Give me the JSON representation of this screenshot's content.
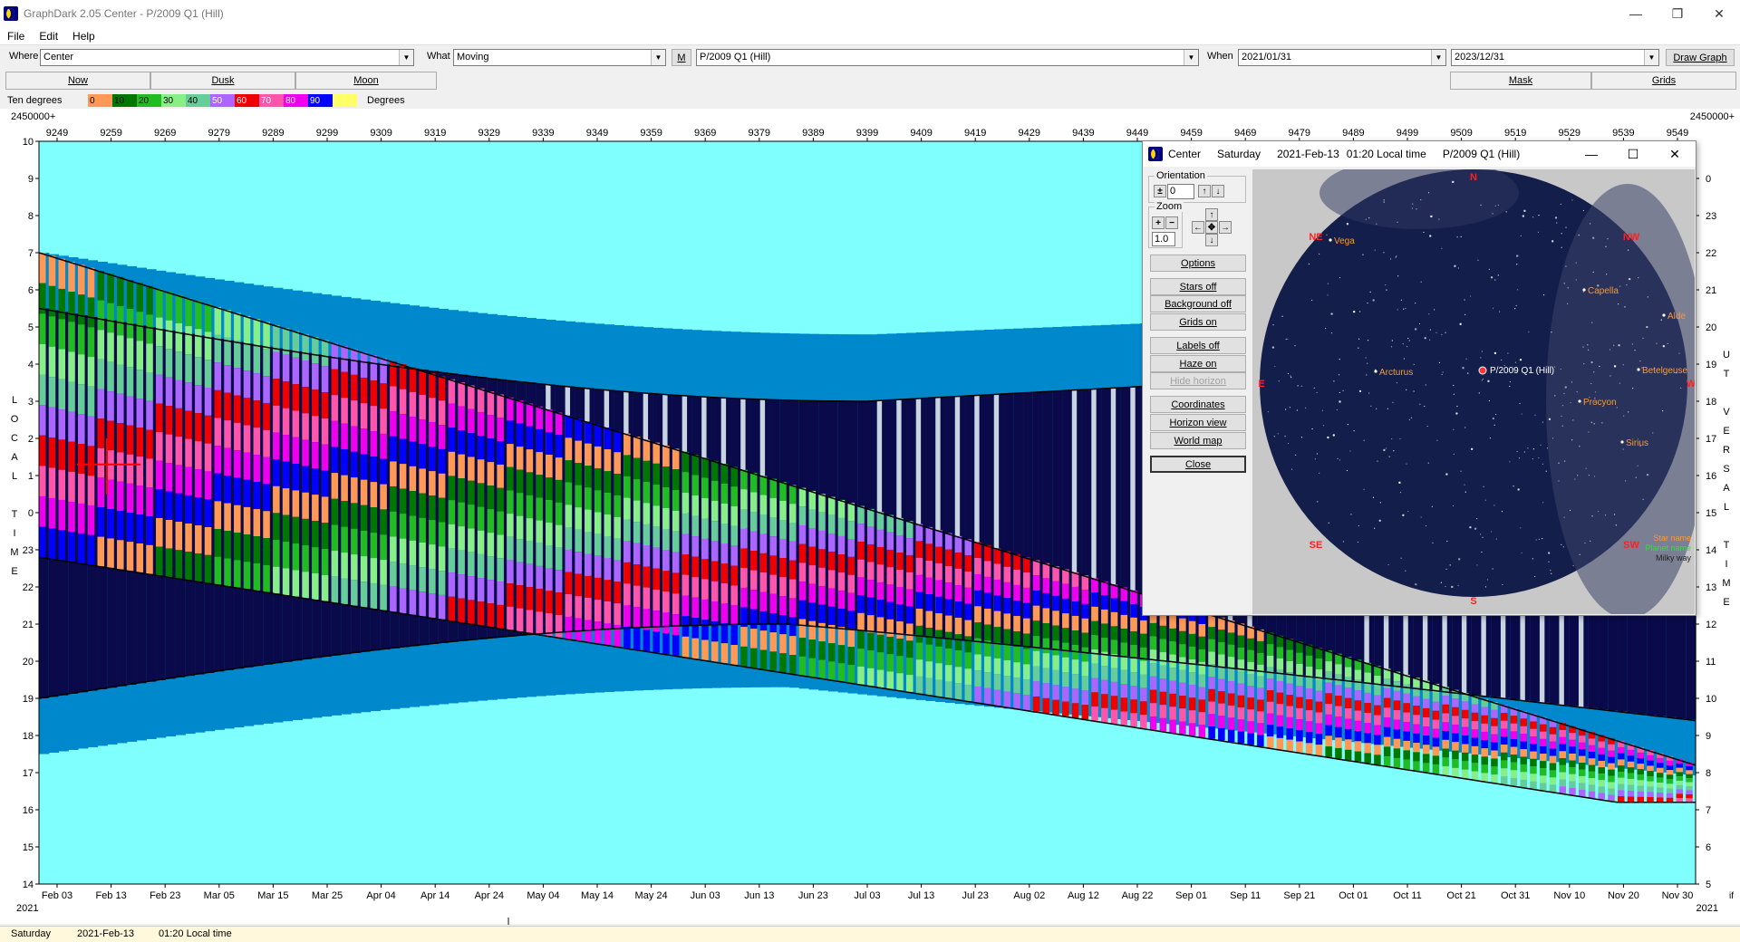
{
  "window": {
    "title": "GraphDark 2.05  Center  -  P/2009 Q1 (Hill)",
    "controls": [
      "—",
      "❐",
      "✕"
    ]
  },
  "menu": [
    "File",
    "Edit",
    "Help"
  ],
  "toolbar": {
    "where_label": "Where",
    "where_value": "Center",
    "what_label": "What",
    "what_value": "Moving",
    "m_button": "M",
    "object_value": "P/2009 Q1 (Hill)",
    "when_label": "When",
    "start_date": "2021/01/31",
    "end_date": "2023/12/31",
    "draw_button": "Draw Graph"
  },
  "tabs": {
    "now": "Now",
    "dusk": "Dusk",
    "moon": "Moon",
    "mask": "Mask",
    "grids": "Grids"
  },
  "legend": {
    "label": "Ten degrees",
    "unit": "Degrees",
    "swatches": [
      {
        "text": "0",
        "color": "#ff9955"
      },
      {
        "text": "10",
        "color": "#007700"
      },
      {
        "text": "20",
        "color": "#22bb22"
      },
      {
        "text": "30",
        "color": "#88ee88"
      },
      {
        "text": "40",
        "color": "#66cc99"
      },
      {
        "text": "50",
        "color": "#aa66ff"
      },
      {
        "text": "60",
        "color": "#ee0000"
      },
      {
        "text": "70",
        "color": "#ff55aa"
      },
      {
        "text": "80",
        "color": "#ee00ee"
      },
      {
        "text": "90",
        "color": "#0000ff"
      },
      {
        "text": "",
        "color": "#ffff66"
      }
    ]
  },
  "chart": {
    "jd_base_left": "2450000+",
    "jd_base_right": "2450000+",
    "jd_ticks": [
      "9249",
      "9259",
      "9269",
      "9279",
      "9289",
      "9299",
      "9309",
      "9319",
      "9329",
      "9339",
      "9349",
      "9359",
      "9369",
      "9379",
      "9389",
      "9399",
      "9409",
      "9419",
      "9429",
      "9439",
      "9449",
      "9459",
      "9469",
      "9479",
      "9489",
      "9499",
      "9509",
      "9519",
      "9529",
      "9539",
      "9549"
    ],
    "date_ticks": [
      "Feb 03",
      "Feb 13",
      "Feb 23",
      "Mar 05",
      "Mar 15",
      "Mar 25",
      "Apr 04",
      "Apr 14",
      "Apr 24",
      "May 04",
      "May 14",
      "May 24",
      "Jun 03",
      "Jun 13",
      "Jun 23",
      "Jul 03",
      "Jul 13",
      "Jul 23",
      "Aug 02",
      "Aug 12",
      "Aug 22",
      "Sep 01",
      "Sep 11",
      "Sep 21",
      "Oct 01",
      "Oct 11",
      "Oct 21",
      "Oct 31",
      "Nov 10",
      "Nov 20",
      "Nov 30"
    ],
    "year_left": "2021",
    "year_right": "2021",
    "left_hours": [
      "10",
      "9",
      "8",
      "7",
      "6",
      "5",
      "4",
      "3",
      "2",
      "1",
      "0",
      "23",
      "22",
      "21",
      "20",
      "19",
      "18",
      "17",
      "16",
      "15",
      "14"
    ],
    "right_hours": [
      "0",
      "23",
      "22",
      "21",
      "20",
      "19",
      "18",
      "17",
      "16",
      "15",
      "14",
      "13",
      "12",
      "11",
      "10",
      "9",
      "8",
      "7",
      "6",
      "5"
    ],
    "left_title": [
      "L",
      "O",
      "C",
      "A",
      "L",
      "",
      "T",
      "I",
      "M",
      "E"
    ],
    "right_title": [
      "U",
      "T",
      "",
      "V",
      "E",
      "R",
      "S",
      "A",
      "L",
      "",
      "T",
      "I",
      "M",
      "E"
    ],
    "right_corner": "if",
    "colors": {
      "sky": "#80ffff",
      "night": "#0a0a4a",
      "twilight": "#0088cc",
      "moon_bars": "#c8d4e0"
    }
  },
  "popup": {
    "title_app": "Center",
    "title_day": "Saturday",
    "title_date": "2021-Feb-13",
    "title_time": "01:20 Local time",
    "title_object": "P/2009 Q1 (Hill)",
    "orientation_label": "Orientation",
    "orientation_value": "0",
    "zoom_label": "Zoom",
    "zoom_value": "1.0",
    "buttons": {
      "options": "Options",
      "stars": "Stars off",
      "background": "Background off",
      "grids": "Grids on",
      "labels": "Labels off",
      "haze": "Haze on",
      "hide_horizon": "Hide horizon",
      "coordinates": "Coordinates",
      "horizon_view": "Horizon view",
      "world_map": "World map",
      "close": "Close"
    },
    "sky": {
      "directions": {
        "N": "N",
        "NE": "NE",
        "NW": "NW",
        "E": "E",
        "W": "W",
        "SE": "SE",
        "SW": "SW",
        "S": "S"
      },
      "stars": [
        {
          "name": "Vega"
        },
        {
          "name": "Capella"
        },
        {
          "name": "Alde"
        },
        {
          "name": "Arcturus"
        },
        {
          "name": "Betelgeuse"
        },
        {
          "name": "Procyon"
        },
        {
          "name": "Sirius"
        }
      ],
      "target": "P/2009 Q1 (Hill)",
      "legend_star": "Star name",
      "legend_planet": "Planet name",
      "legend_milky": "Milky way"
    }
  },
  "status": {
    "day": "Saturday",
    "date": "2021-Feb-13",
    "time": "01:20   Local time"
  }
}
